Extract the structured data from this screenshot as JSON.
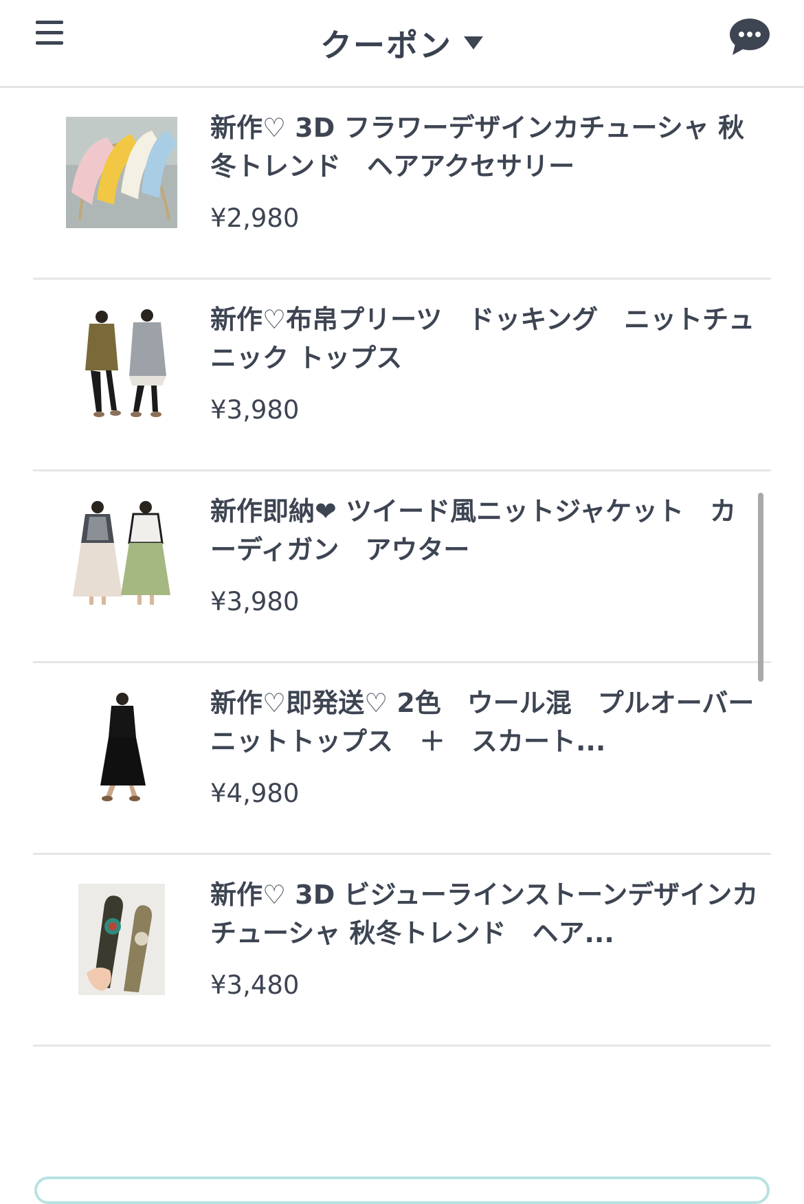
{
  "header": {
    "title": "クーポン",
    "menu_icon": "hamburger-icon",
    "dropdown_icon": "caret-down-icon",
    "chat_icon": "chat-bubble-icon"
  },
  "products": [
    {
      "name": "新作♡ 3D フラワーデザインカチューシャ 秋冬トレンド　ヘアアクセサリー",
      "price": "¥2,980",
      "image": "flower-headband-photo"
    },
    {
      "name": "新作♡布帛プリーツ　ドッキング　ニットチュニック トップス",
      "price": "¥3,980",
      "image": "knit-tunic-photo"
    },
    {
      "name": "新作即納❤ ツイード風ニットジャケット　カーディガン　アウター",
      "price": "¥3,980",
      "image": "tweed-jacket-photo"
    },
    {
      "name": "新作♡即発送♡ 2色　ウール混　プルオーバーニットトップス　＋　スカート...",
      "price": "¥4,980",
      "image": "black-dress-photo"
    },
    {
      "name": "新作♡ 3D ビジューラインストーンデザインカチューシャ 秋冬トレンド　ヘア...",
      "price": "¥3,480",
      "image": "bijou-headband-photo"
    }
  ],
  "colors": {
    "text": "#3d4452",
    "divider": "#e6e6e6",
    "accent_border": "#b7e2e2"
  }
}
